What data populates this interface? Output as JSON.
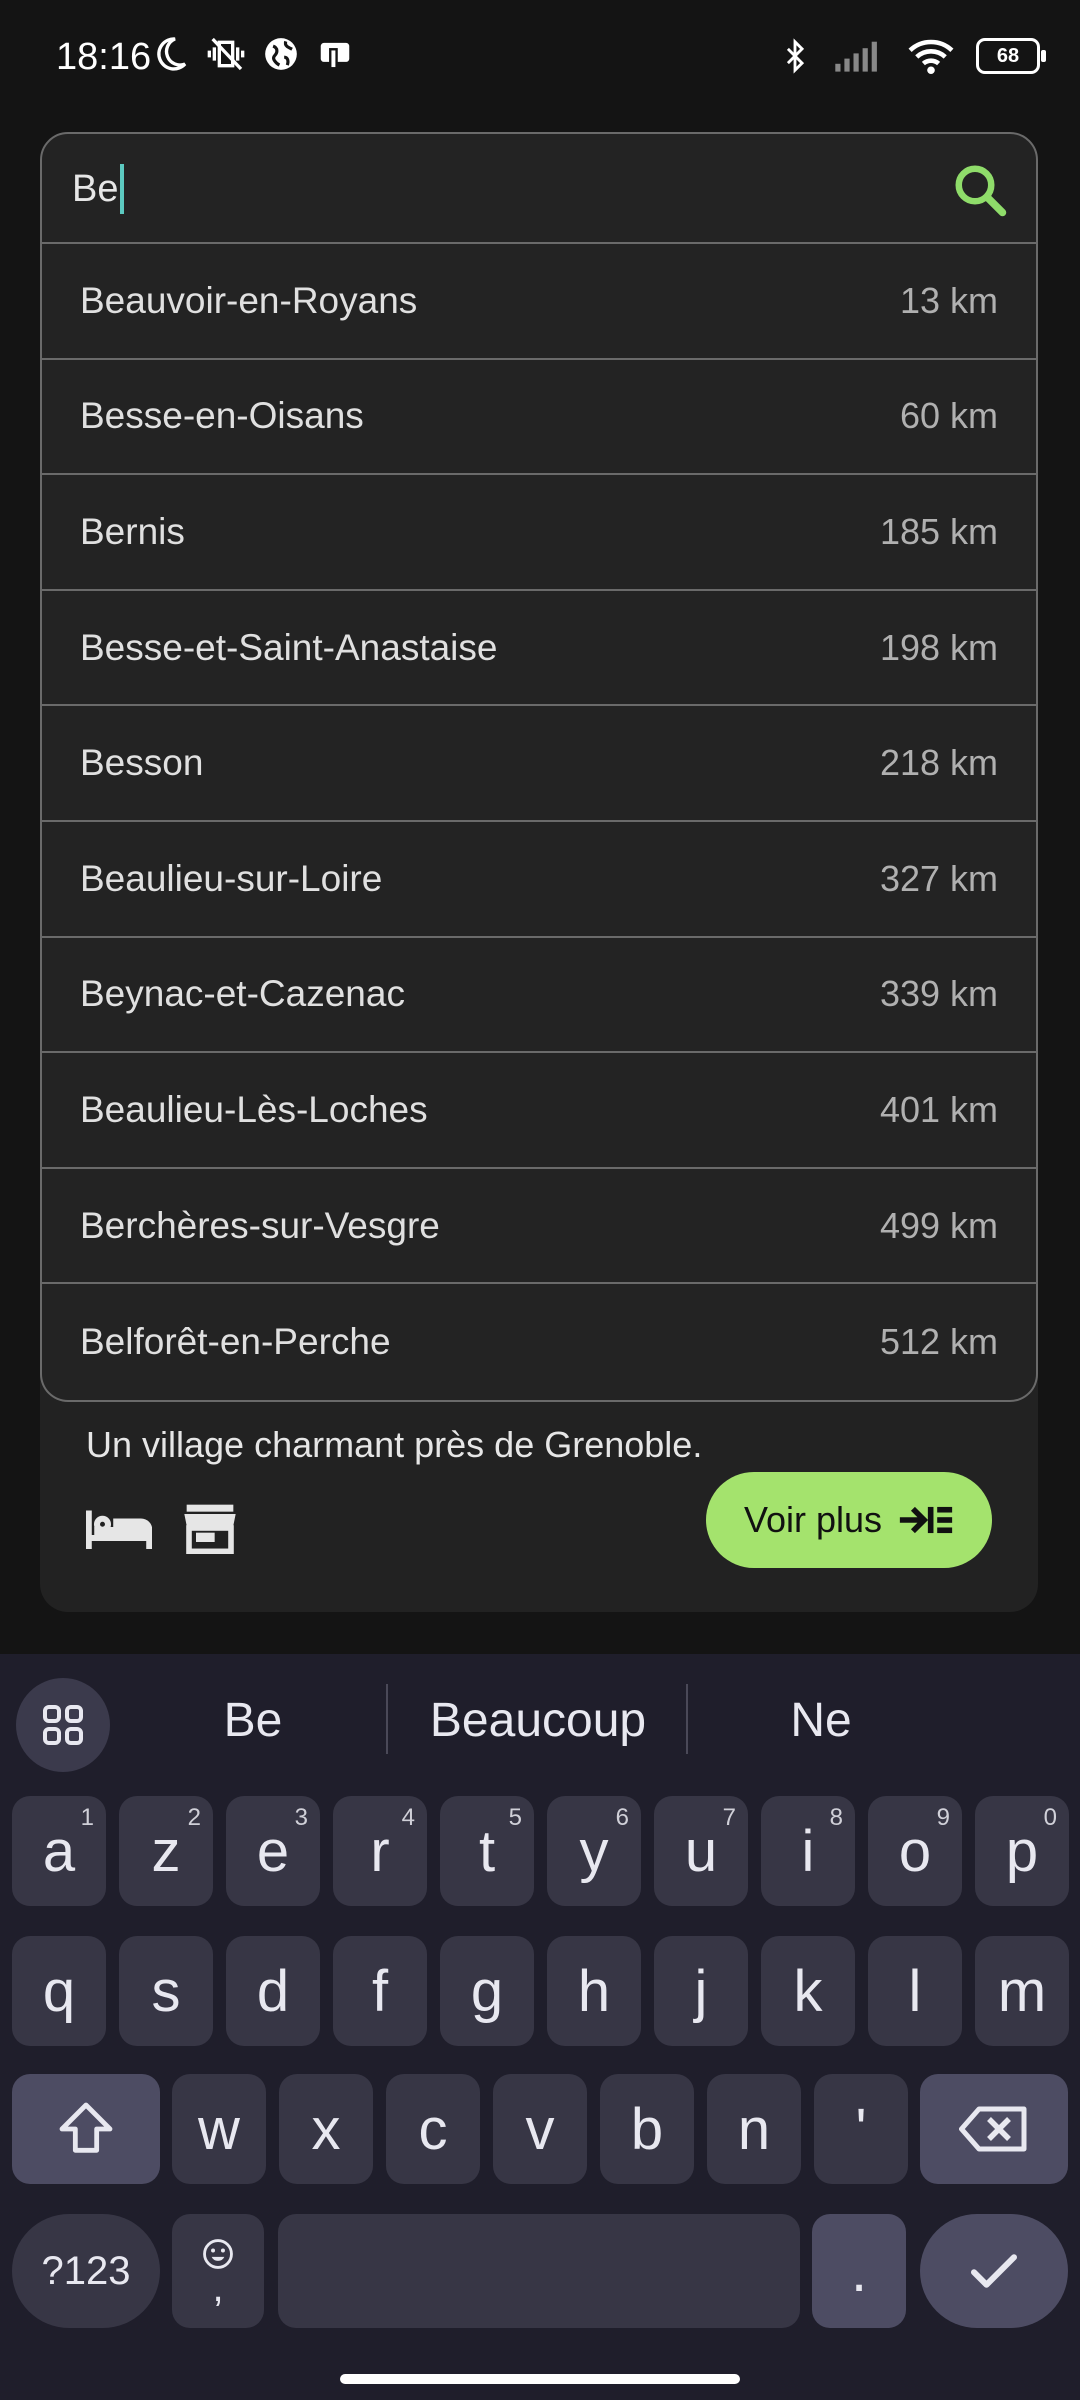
{
  "status_bar": {
    "time": "18:16",
    "battery": "68",
    "left_icons": [
      "moon-icon",
      "vibrate-off-icon",
      "globe-icon",
      "screen-icon"
    ],
    "right_icons": [
      "bluetooth-icon",
      "signal-icon",
      "wifi-icon",
      "battery-icon"
    ]
  },
  "search": {
    "value": "Be",
    "accent_color": "#8fdc6a"
  },
  "results": [
    {
      "name": "Beauvoir-en-Royans",
      "distance": "13 km"
    },
    {
      "name": "Besse-en-Oisans",
      "distance": "60 km"
    },
    {
      "name": "Bernis",
      "distance": "185 km"
    },
    {
      "name": "Besse-et-Saint-Anastaise",
      "distance": "198 km"
    },
    {
      "name": "Besson",
      "distance": "218 km"
    },
    {
      "name": "Beaulieu-sur-Loire",
      "distance": "327 km"
    },
    {
      "name": "Beynac-et-Cazenac",
      "distance": "339 km"
    },
    {
      "name": "Beaulieu-Lès-Loches",
      "distance": "401 km"
    },
    {
      "name": "Berchères-sur-Vesgre",
      "distance": "499 km"
    },
    {
      "name": "Belforêt-en-Perche",
      "distance": "512 km"
    }
  ],
  "card": {
    "description": "Un village charmant près de Grenoble.",
    "button_label": "Voir plus",
    "amenities": [
      "bed-icon",
      "store-icon"
    ]
  },
  "keyboard": {
    "suggestions": [
      "Be",
      "Beaucoup",
      "Ne"
    ],
    "row1": [
      {
        "k": "a",
        "h": "1"
      },
      {
        "k": "z",
        "h": "2"
      },
      {
        "k": "e",
        "h": "3"
      },
      {
        "k": "r",
        "h": "4"
      },
      {
        "k": "t",
        "h": "5"
      },
      {
        "k": "y",
        "h": "6"
      },
      {
        "k": "u",
        "h": "7"
      },
      {
        "k": "i",
        "h": "8"
      },
      {
        "k": "o",
        "h": "9"
      },
      {
        "k": "p",
        "h": "0"
      }
    ],
    "row2": [
      "q",
      "s",
      "d",
      "f",
      "g",
      "h",
      "j",
      "k",
      "l",
      "m"
    ],
    "row3": [
      "w",
      "x",
      "c",
      "v",
      "b",
      "n",
      "'"
    ],
    "symbols_label": "?123",
    "emoji_comma_label": ",",
    "period_label": "."
  }
}
